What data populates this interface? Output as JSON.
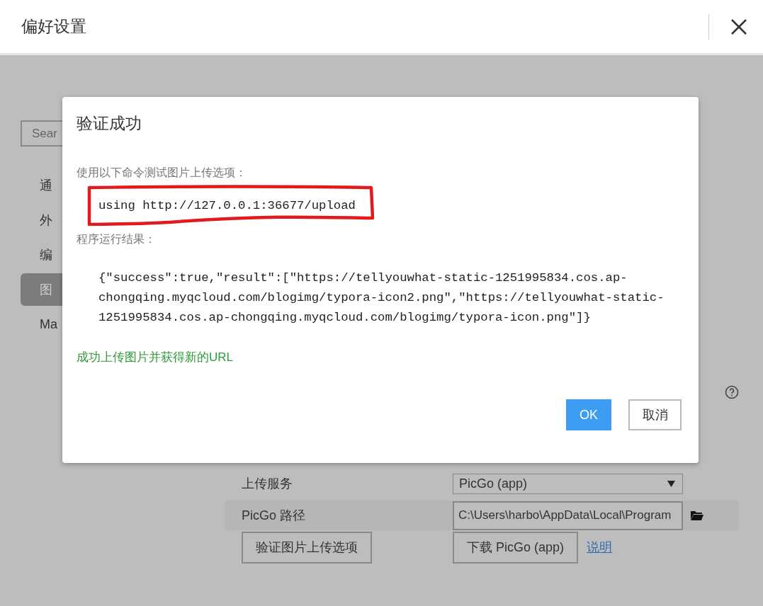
{
  "window": {
    "title": "偏好设置"
  },
  "sidebar": {
    "search": {
      "placeholder": "Sear"
    },
    "items": [
      {
        "label": "通",
        "selected": false
      },
      {
        "label": "外",
        "selected": false
      },
      {
        "label": "编",
        "selected": false
      },
      {
        "label": "图",
        "selected": true
      },
      {
        "label": "Ma",
        "selected": false
      }
    ]
  },
  "settings": {
    "rows": [
      {
        "kind": "select",
        "label": "上传服务",
        "value": "PicGo (app)"
      },
      {
        "kind": "path",
        "label": "PicGo 路径",
        "value": "C:\\Users\\harbo\\AppData\\Local\\Program"
      }
    ],
    "verify_button": "验证图片上传选项",
    "download_button": "下载 PicGo (app)",
    "link": "说明"
  },
  "dialog": {
    "title": "验证成功",
    "command_label": "使用以下命令测试图片上传选项：",
    "command": "using http://127.0.0.1:36677/upload",
    "result_label": "程序运行结果：",
    "result": "{\"success\":true,\"result\":[\"https://tellyouwhat-static-1251995834.cos.ap-chongqing.myqcloud.com/blogimg/typora-icon2.png\",\"https://tellyouwhat-static-1251995834.cos.ap-chongqing.myqcloud.com/blogimg/typora-icon.png\"]}",
    "status": "成功上传图片并获得新的URL",
    "ok": "OK",
    "cancel": "取消"
  }
}
